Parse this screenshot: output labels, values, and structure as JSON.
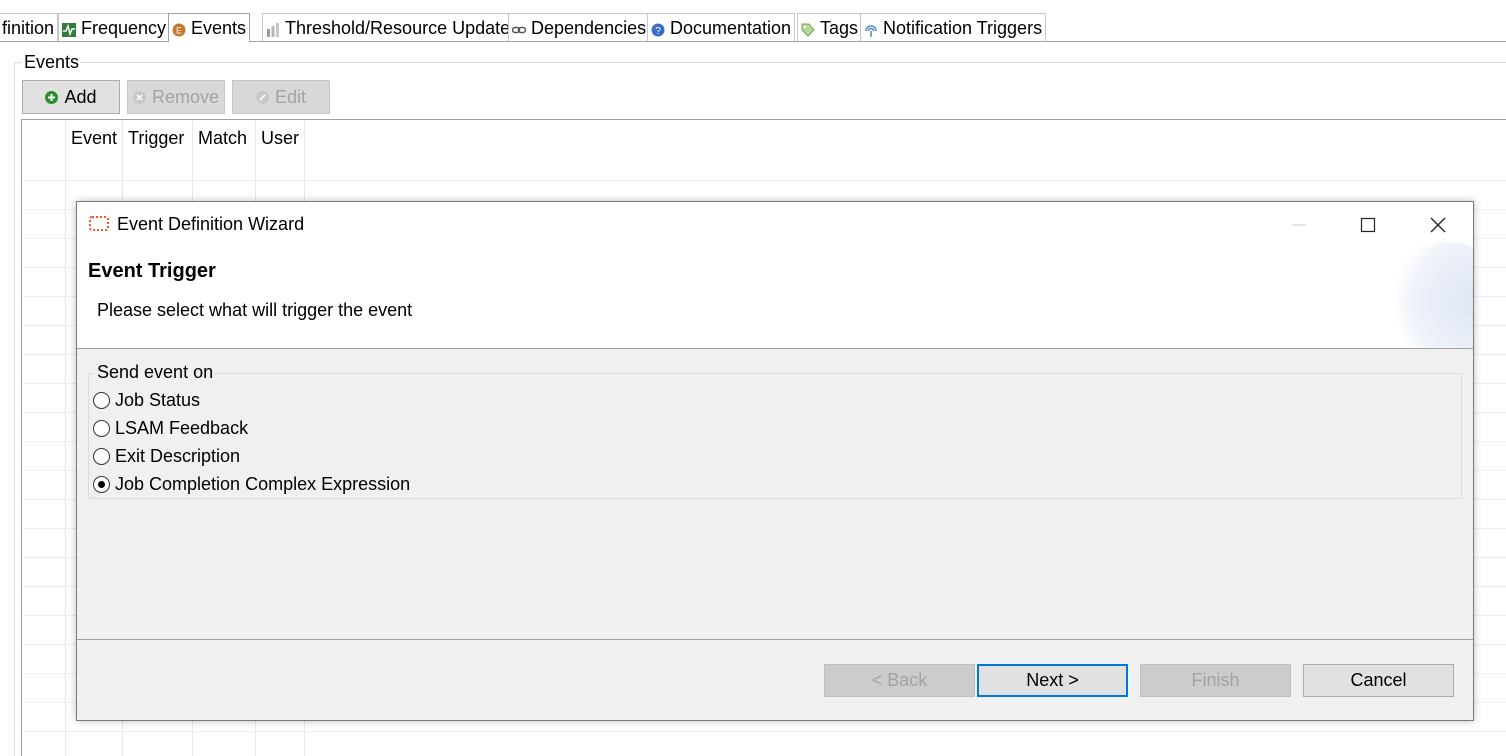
{
  "tabs": [
    {
      "label": "finition",
      "icon": "",
      "active": false
    },
    {
      "label": "Frequency",
      "icon": "frequency-icon",
      "active": false
    },
    {
      "label": "Events",
      "icon": "events-icon",
      "active": true
    },
    {
      "label": "Threshold/Resource Update",
      "icon": "threshold-icon",
      "active": false
    },
    {
      "label": "Dependencies",
      "icon": "link-icon",
      "active": false
    },
    {
      "label": "Documentation",
      "icon": "info-icon",
      "active": false
    },
    {
      "label": "Tags",
      "icon": "tag-icon",
      "active": false
    },
    {
      "label": "Notification Triggers",
      "icon": "notification-icon",
      "active": false
    }
  ],
  "events_panel": {
    "title": "Events",
    "buttons": {
      "add": "Add",
      "remove": "Remove",
      "edit": "Edit"
    },
    "columns": [
      "Event",
      "Trigger",
      "Match",
      "User"
    ]
  },
  "dialog": {
    "window_title": "Event Definition Wizard",
    "heading": "Event Trigger",
    "description": "Please select what will trigger the event",
    "group_title": "Send event on",
    "options": [
      {
        "label": "Job Status",
        "selected": false
      },
      {
        "label": "LSAM Feedback",
        "selected": false
      },
      {
        "label": "Exit Description",
        "selected": false
      },
      {
        "label": "Job Completion Complex Expression",
        "selected": true
      }
    ],
    "buttons": {
      "back": "< Back",
      "next": "Next >",
      "finish": "Finish",
      "cancel": "Cancel"
    }
  },
  "colors": {
    "accent": "#0078d7",
    "app_icon": "#e8562a",
    "add_icon": "#2e8b2e"
  }
}
